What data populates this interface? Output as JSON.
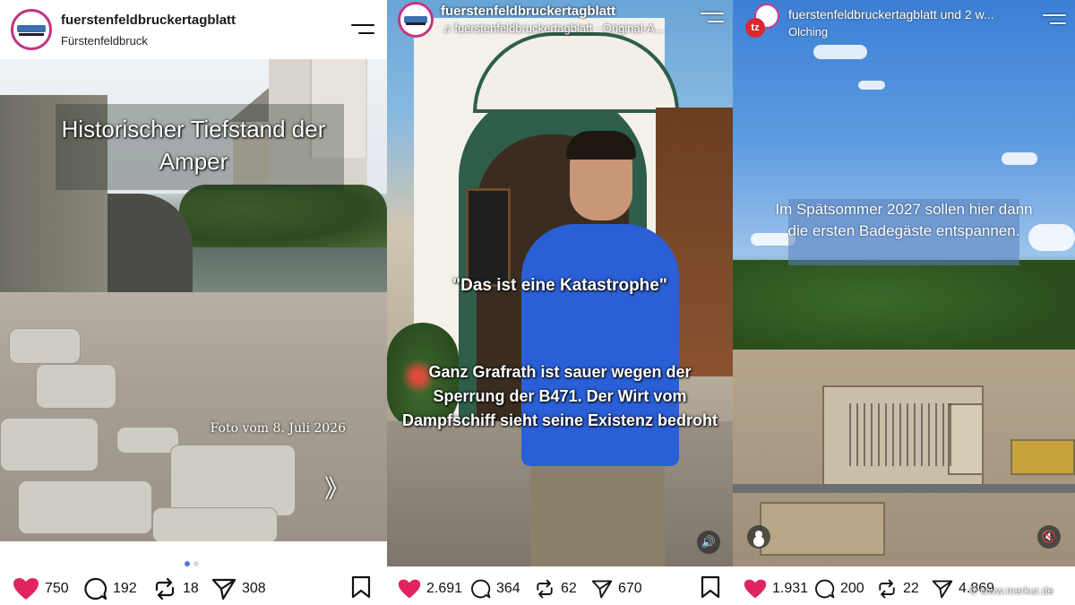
{
  "posts": [
    {
      "username": "fuerstenfeldbruckertagblatt",
      "location": "Fürstenfeldbruck",
      "overlay_title": "Historischer Tiefstand der Amper",
      "photo_caption": "Foto vom 8. Juli 2026",
      "next_arrow": "》",
      "carousel": {
        "total": 2,
        "active": 1
      },
      "stats": {
        "likes": "750",
        "comments": "192",
        "reposts": "18",
        "shares": "308"
      }
    },
    {
      "username": "fuerstenfeldbruckertagblatt",
      "audio_label": "♫ fuerstenfeldbruckertagblatt · Original-A...",
      "quote": "\"Das ist eine Katastrophe\"",
      "caption": "Ganz Grafrath ist sauer wegen der Sperrung der B471. Der Wirt vom Dampfschiff sieht seine Existenz bedroht",
      "volume_icon": "🔊",
      "stats": {
        "likes": "2.691",
        "comments": "364",
        "reposts": "62",
        "shares": "670"
      }
    },
    {
      "username": "fuerstenfeldbruckertagblatt",
      "username_suffix": "und 2 w...",
      "location": "Olching",
      "badge": "tz",
      "caption": "Im Spätsommer 2027 sollen hier dann die ersten Badegäste entspannen.",
      "mute_icon": "🔇",
      "stats": {
        "likes": "1.931",
        "comments": "200",
        "reposts": "22",
        "shares": "4.869"
      }
    }
  ],
  "watermark": "© www.merkur.de",
  "colors": {
    "like": "#e0245e",
    "carousel_active": "#4a7bdc",
    "carousel_inactive": "#cfd8e6",
    "avatar_ring": "#c13584"
  }
}
